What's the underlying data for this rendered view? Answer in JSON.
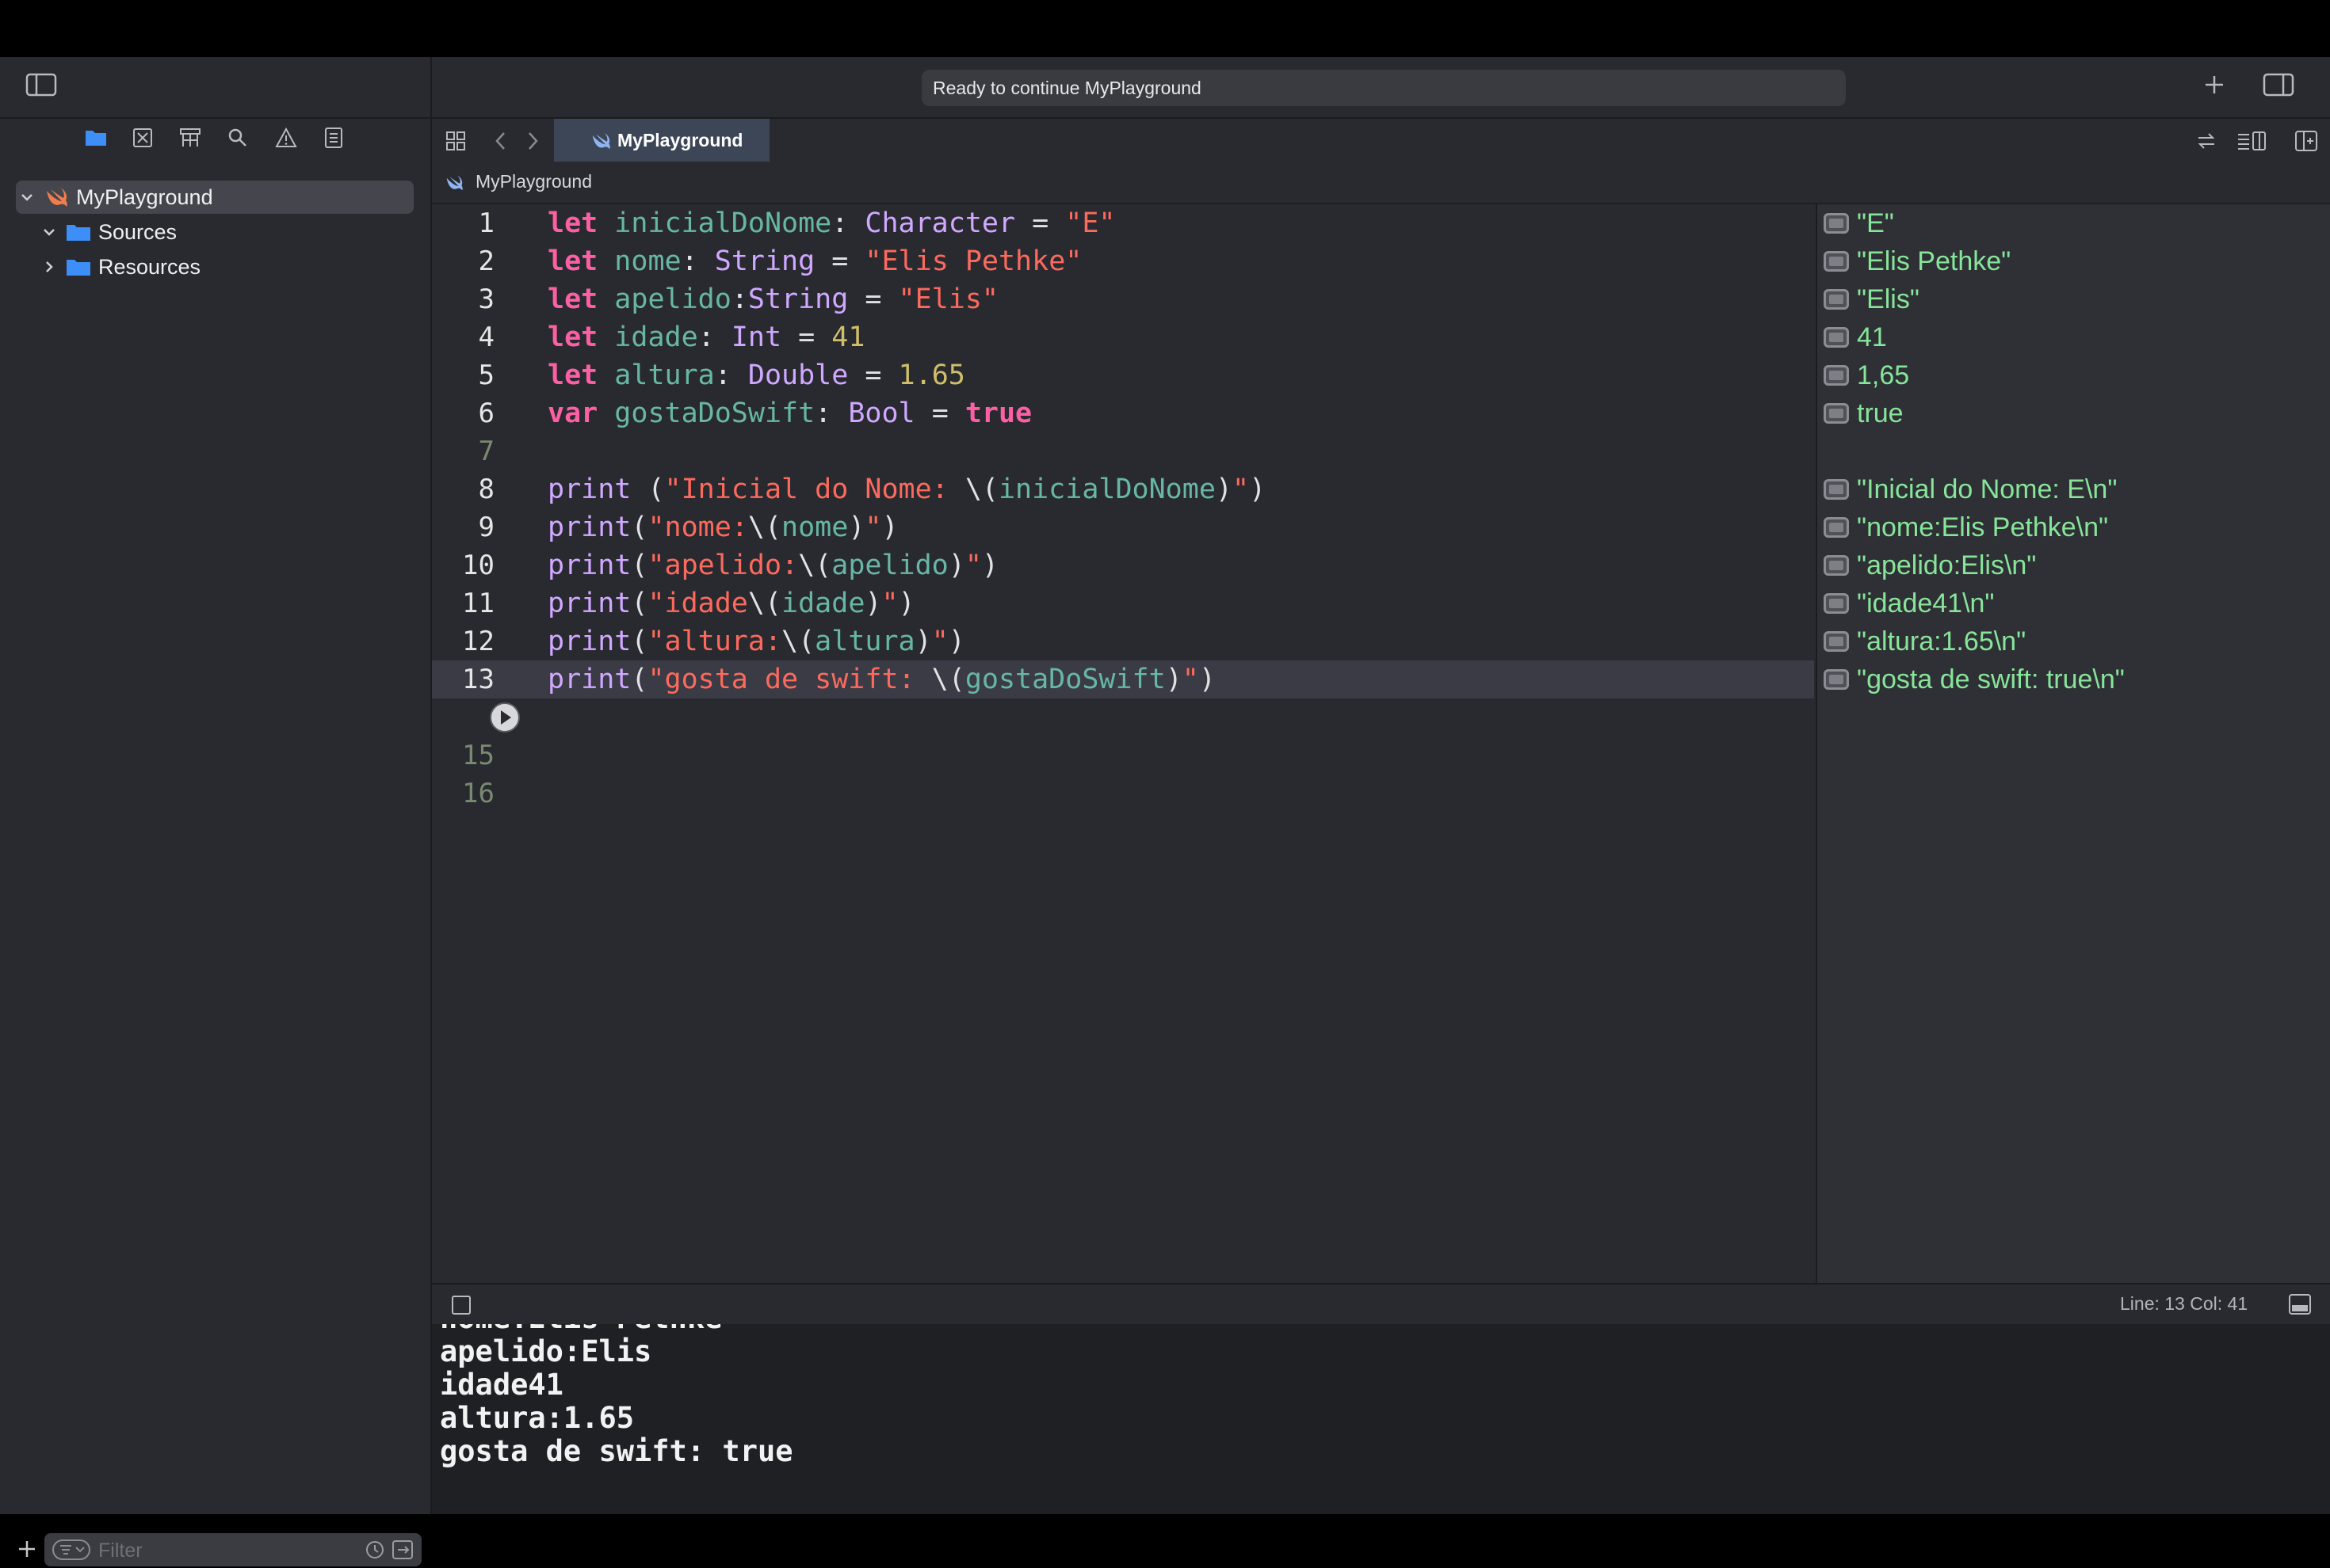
{
  "status": {
    "text": "Ready to continue MyPlayground"
  },
  "sidebar": {
    "tree": [
      {
        "label": "MyPlayground",
        "expanded": true,
        "selected": true
      },
      {
        "label": "Sources",
        "expanded": true
      },
      {
        "label": "Resources",
        "expanded": false
      }
    ],
    "filter_placeholder": "Filter"
  },
  "tab": {
    "label": "MyPlayground"
  },
  "jumpbar": {
    "label": "MyPlayground"
  },
  "editor": {
    "line_numbers": [
      "1",
      "2",
      "3",
      "4",
      "5",
      "6",
      "7",
      "8",
      "9",
      "10",
      "11",
      "12",
      "13",
      "",
      "15",
      "16"
    ],
    "lines": [
      "let inicialDoNome: Character = \"E\"",
      "let nome: String = \"Elis Pethke\"",
      "let apelido:String = \"Elis\"",
      "let idade: Int = 41",
      "let altura: Double = 1.65",
      "var gostaDoSwift: Bool = true",
      "",
      "print (\"Inicial do Nome: \\(inicialDoNome)\")",
      "print(\"nome:\\(nome)\")",
      "print(\"apelido:\\(apelido)\")",
      "print(\"idade\\(idade)\")",
      "print(\"altura:\\(altura)\")",
      "print(\"gosta de swift: \\(gostaDoSwift)\")"
    ],
    "current_line": 13
  },
  "results": [
    "\"E\"",
    "\"Elis Pethke\"",
    "\"Elis\"",
    "41",
    "1,65",
    "true",
    "",
    "\"Inicial do Nome: E\\n\"",
    "\"nome:Elis Pethke\\n\"",
    "\"apelido:Elis\\n\"",
    "\"idade41\\n\"",
    "\"altura:1.65\\n\"",
    "\"gosta de swift: true\\n\""
  ],
  "debugbar": {
    "position": "Line: 13  Col: 41"
  },
  "console": {
    "partial_line": "nome:Elis Pethke",
    "lines": [
      "apelido:Elis",
      "idade41",
      "altura:1.65",
      "gosta de swift: true"
    ]
  },
  "colors": {
    "keyword": "#fc5fa3",
    "string": "#fc6a5d",
    "number": "#d0bf69",
    "identifier": "#67b7a4",
    "type_function": "#d0a8ff",
    "result": "#87e59a",
    "tab": "#3c4657",
    "folder": "#3d8ef6"
  },
  "icons": [
    "sidebar-toggle-icon",
    "folder-icon",
    "source-control-icon",
    "symbol-icon",
    "search-icon",
    "warning-icon",
    "report-icon",
    "disclosure-icon",
    "swift-icon",
    "plus-icon",
    "inspector-toggle-icon",
    "grid-icon",
    "chevron-left-icon",
    "chevron-right-icon",
    "refresh-icon",
    "editor-options-icon",
    "split-editor-icon",
    "run-icon",
    "console-toggle-icon",
    "filter-options-icon",
    "recent-icon",
    "scm-filter-icon"
  ]
}
